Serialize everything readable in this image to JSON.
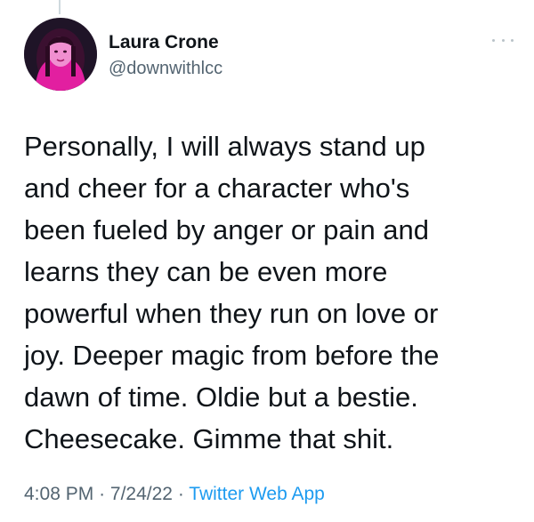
{
  "author": {
    "display_name": "Laura Crone",
    "handle": "@downwithlcc"
  },
  "tweet": {
    "lines": [
      "Personally, I will always stand up",
      "and cheer for a character who's",
      "been fueled by anger or pain and",
      "learns they can be even more",
      "powerful when they run on love or",
      "joy. Deeper magic from before the",
      "dawn of time. Oldie but a bestie.",
      "Cheesecake. Gimme that shit."
    ]
  },
  "meta": {
    "time": "4:08 PM",
    "separator": "·",
    "date": "7/24/22",
    "source": "Twitter Web App"
  },
  "icons": {
    "more": "more-horizontal-icon"
  },
  "colors": {
    "text_primary": "#0f1419",
    "text_secondary": "#536471",
    "link": "#1d9bf0",
    "avatar_accent": "#e21fa0"
  }
}
